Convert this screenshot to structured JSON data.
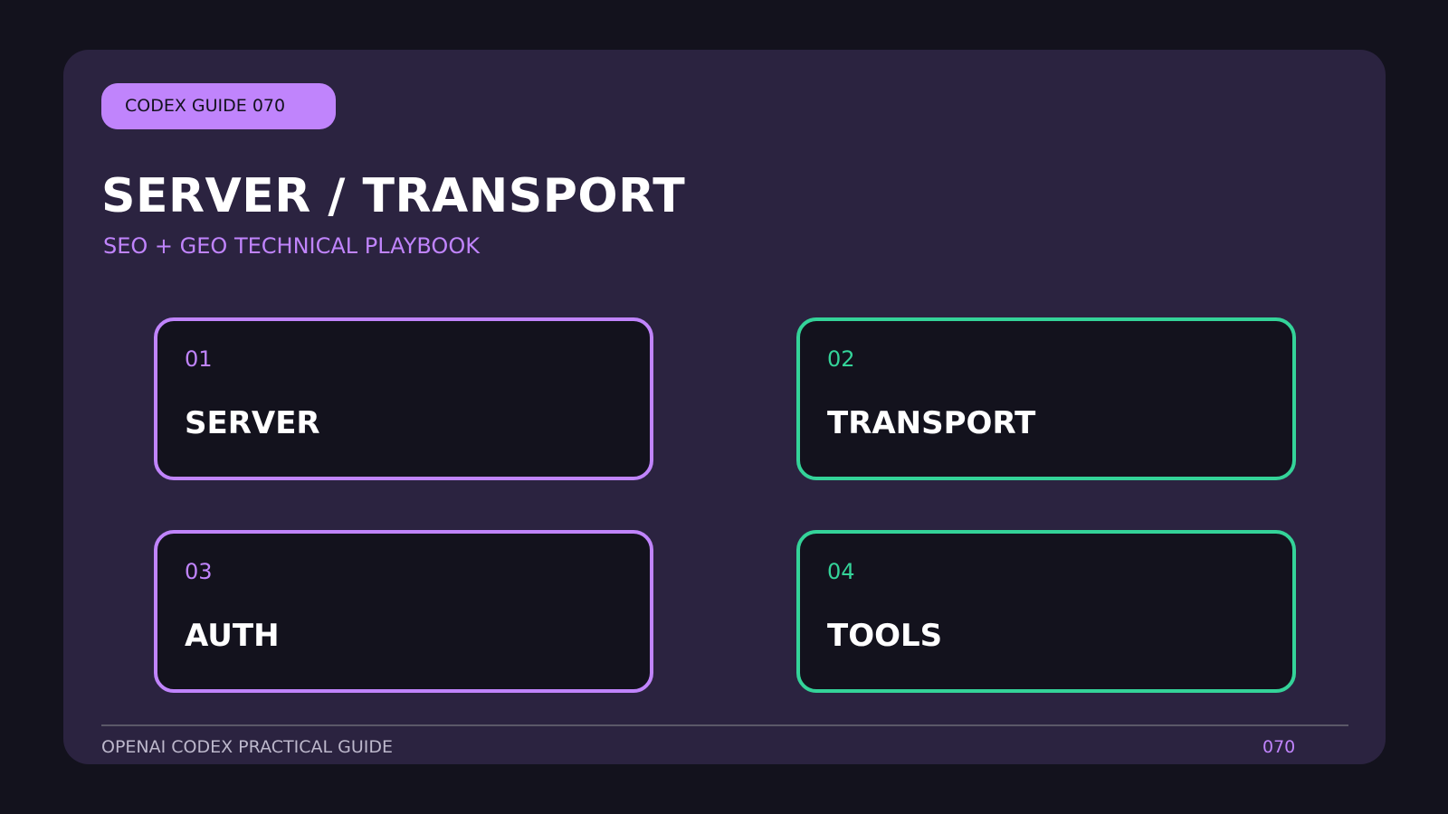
{
  "badge": "CODEX GUIDE 070",
  "title": "SERVER / TRANSPORT",
  "subtitle": "SEO + GEO TECHNICAL PLAYBOOK",
  "cards": [
    {
      "number": "01",
      "label": "SERVER",
      "accent": "#c084fc"
    },
    {
      "number": "02",
      "label": "TRANSPORT",
      "accent": "#34d399"
    },
    {
      "number": "03",
      "label": "AUTH",
      "accent": "#c084fc"
    },
    {
      "number": "04",
      "label": "TOOLS",
      "accent": "#34d399"
    }
  ],
  "footer": {
    "left": "OPENAI CODEX PRACTICAL GUIDE",
    "right": "070"
  },
  "colors": {
    "background": "#13121d",
    "panel": "#2b2340",
    "purple": "#c084fc",
    "green": "#34d399"
  }
}
